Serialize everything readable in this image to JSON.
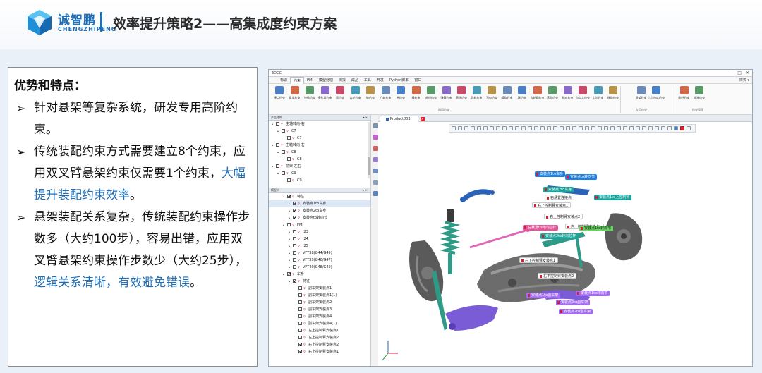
{
  "slide": {
    "logo_cn": "诚智鹏",
    "logo_en": "CHENGZHIPENG",
    "title": "效率提升策略2——高集成度约束方案"
  },
  "textbox": {
    "heading": "优势和特点：",
    "bullets": [
      {
        "text": "针对悬架等复杂系统，研发专用高阶约束。",
        "highlight": ""
      },
      {
        "text": "传统装配约束方式需要建立8个约束，应用双叉臂悬架约束仅需要1个约束，",
        "highlight": "大幅提升装配约束效率",
        "tail": "。"
      },
      {
        "text": "悬架装配关系复杂，传统装配约束操作步数多（大约100步），容易出错，应用双叉臂悬架约束操作步数少（大约25步），",
        "highlight": "逻辑关系清晰，有效避免错误",
        "tail": "。"
      }
    ],
    "bullet_glyph": "➢"
  },
  "app": {
    "window_title": "3DCC",
    "window_controls": [
      "—",
      "□",
      "✕"
    ],
    "menu": [
      "标识",
      "约束",
      "PMI",
      "模型处理",
      "测报",
      "成品",
      "工具",
      "开发",
      "Python脚本",
      "窗口"
    ],
    "menu_right": "样式 ▾",
    "active_menu_index": 1,
    "ribbon_buttons": [
      "接点约束",
      "角度约束",
      "铰链约束",
      "多孔盘约束",
      "面约束",
      "齿轮约束",
      "轨约束",
      "凸轮约束",
      "带约束",
      "线约束",
      "曲线约束",
      "弹簧约束",
      "直线约束",
      "导轨约束",
      "万向约束",
      "螺旋约束",
      "球约束",
      "齿轮副约束",
      "滚动约束",
      "相对约束",
      "自定义约束",
      "定位约束",
      "移动约束",
      "悬架约束",
      "六自由度约束",
      "刚性约束",
      "标准约束"
    ],
    "ribbon_group_labels": [
      "通用约束",
      "专用约束",
      "约束管理"
    ],
    "panel1_title": "产品结构",
    "panel1_items": [
      {
        "label": "主轴转向-右",
        "checked": false,
        "level": 0
      },
      {
        "label": "C7",
        "checked": false,
        "level": 1
      },
      {
        "label": "C7",
        "checked": false,
        "level": 2
      },
      {
        "label": "主轴转向-右",
        "checked": false,
        "level": 0
      },
      {
        "label": "C8",
        "checked": false,
        "level": 1
      },
      {
        "label": "C8",
        "checked": false,
        "level": 2
      },
      {
        "label": "前束-左右",
        "checked": false,
        "level": 0
      },
      {
        "label": "C9",
        "checked": false,
        "level": 1
      },
      {
        "label": "C9",
        "checked": false,
        "level": 2
      }
    ],
    "panel2_title": "模型树",
    "panel2_items": [
      {
        "label": "特征",
        "checked": true,
        "level": 0,
        "selected": false
      },
      {
        "label": "安装点1to车身",
        "checked": true,
        "level": 1,
        "selected": true
      },
      {
        "label": "安装点2to车身",
        "checked": true,
        "level": 1,
        "selected": false
      },
      {
        "label": "安装点to转向节",
        "checked": true,
        "level": 1,
        "selected": false
      },
      {
        "label": "PMI",
        "checked": false,
        "level": 0,
        "selected": false
      },
      {
        "label": "J23",
        "checked": false,
        "level": 1,
        "selected": false
      },
      {
        "label": "J24",
        "checked": false,
        "level": 1,
        "selected": false
      },
      {
        "label": "J25",
        "checked": false,
        "level": 1,
        "selected": false
      },
      {
        "label": "VFT38(G44/G45)",
        "checked": false,
        "level": 1,
        "selected": false
      },
      {
        "label": "VFT39(G46/G47)",
        "checked": false,
        "level": 1,
        "selected": false
      },
      {
        "label": "VFT40(G48/G49)",
        "checked": false,
        "level": 1,
        "selected": false
      },
      {
        "label": "车身",
        "checked": true,
        "level": 0,
        "selected": false
      },
      {
        "label": "特征",
        "checked": true,
        "level": 1,
        "selected": false
      },
      {
        "label": "副车架安装点1",
        "checked": false,
        "level": 2,
        "selected": false
      },
      {
        "label": "副车架安装点1(1)",
        "checked": false,
        "level": 2,
        "selected": false
      },
      {
        "label": "副车架安装点2",
        "checked": false,
        "level": 2,
        "selected": false
      },
      {
        "label": "副车架安装点3",
        "checked": false,
        "level": 2,
        "selected": false
      },
      {
        "label": "副车架安装点4",
        "checked": false,
        "level": 2,
        "selected": false
      },
      {
        "label": "副车架安装点4(1)",
        "checked": false,
        "level": 2,
        "selected": false
      },
      {
        "label": "左上控制臂安装点1",
        "checked": false,
        "level": 2,
        "selected": false
      },
      {
        "label": "左上控制臂安装点2",
        "checked": false,
        "level": 2,
        "selected": false
      },
      {
        "label": "右上控制臂安装点2",
        "checked": true,
        "level": 2,
        "selected": false
      },
      {
        "label": "右上控制臂安装点1",
        "checked": true,
        "level": 2,
        "selected": false
      }
    ],
    "doc_tab": "Product003",
    "doc_tab_close": "×",
    "labels": [
      {
        "text": "安装点1to车身",
        "style": "lb-blue"
      },
      {
        "text": "安装点to转向节",
        "style": "lb-blue"
      },
      {
        "text": "安装点2to车身",
        "style": "lb-teal"
      },
      {
        "text": "右悬置连接点",
        "style": "lb-white"
      },
      {
        "text": "安装点1to上控制臂",
        "style": "lb-teal"
      },
      {
        "text": "右上控制臂安装点1",
        "style": "lb-white"
      },
      {
        "text": "右上控制臂安装点2",
        "style": "lb-white"
      },
      {
        "text": "右上控制臂安装点1",
        "style": "lb-white"
      },
      {
        "text": "左悬置to转向拉杆",
        "style": "lb-pink"
      },
      {
        "text": "安装点1to转向节",
        "style": "lb-green"
      },
      {
        "text": "安装点2to转向拉杆",
        "style": "lb-teal"
      },
      {
        "text": "右下控制臂安装点1",
        "style": "lb-white"
      },
      {
        "text": "右下控制臂安装点2",
        "style": "lb-white"
      },
      {
        "text": "安装点1to转向节",
        "style": "lb-purple"
      },
      {
        "text": "安装点1to副车架",
        "style": "lb-purple"
      },
      {
        "text": "安装点2to副车架",
        "style": "lb-purple"
      },
      {
        "text": "安装点2to副车架",
        "style": "lb-purple"
      }
    ],
    "colors": {
      "control_arm_blue": "#2a62b8",
      "spring_green": "#2f9a86",
      "tie_rod_pink": "#e066b8",
      "knuckle_gray": "#555555",
      "lower_arm_purple": "#7a5cd6"
    }
  }
}
